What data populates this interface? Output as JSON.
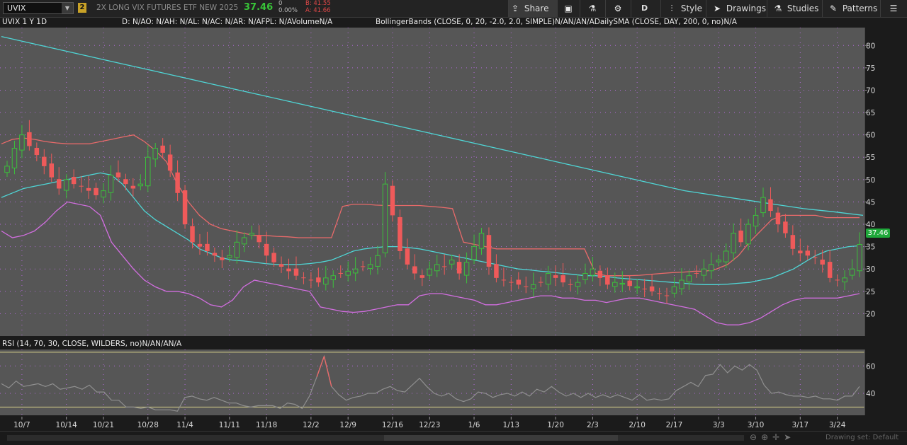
{
  "toolbar": {
    "symbol": "UVIX",
    "link_badge": "2",
    "description": "2X LONG VIX FUTURES ETF NEW 2025",
    "last": "37.46",
    "change": "0",
    "change_pct": "0.00%",
    "bid": "B: 41.55",
    "ask": "A: 41.66",
    "buttons": {
      "share": "Share",
      "period": "D",
      "style": "Style",
      "drawings": "Drawings",
      "studies": "Studies",
      "patterns": "Patterns"
    }
  },
  "header": {
    "chart_label": "UVIX 1 Y 1D",
    "ohlc": "D: N/AO: N/AH: N/AL: N/AC: N/AR: N/AFPL: N/AVolumeN/A",
    "studies": "BollingerBands (CLOSE, 0, 20, -2.0, 2.0, SIMPLE)N/AN/AN/ADailySMA (CLOSE, DAY, 200, 0, no)N/A"
  },
  "rsi_header": "RSI (14, 70, 30, CLOSE, WILDERS, no)N/AN/AN/A",
  "price_tag": "37.46",
  "footer": {
    "drawing_set": "Drawing set: Default"
  },
  "colors": {
    "up": "#3cbf3c",
    "down": "#ef5a5a",
    "upper_band": "#e86a6a",
    "middle_band": "#4fd6d6",
    "lower_band": "#d26ee0",
    "sma": "#4fd6d6",
    "rsi_line": "#8f8f8f",
    "rsi_over": "#e86a6a",
    "rsi_levels": "#d6d08a",
    "grid": "#b06ad6",
    "bg": "#565656",
    "last_tag": "#1fa83a"
  },
  "chart_data": [
    {
      "type": "candlestick",
      "y_axis_ticks": [
        20,
        25,
        30,
        35,
        40,
        45,
        50,
        55,
        60,
        65,
        70,
        75,
        80
      ],
      "ylim": [
        15,
        84
      ],
      "x_tick_labels": [
        "10/7",
        "10/14",
        "10/21",
        "10/28",
        "11/4",
        "11/11",
        "11/18",
        "12/2",
        "12/9",
        "12/16",
        "12/23",
        "1/6",
        "1/13",
        "1/20",
        "2/3",
        "2/10",
        "2/17",
        "3/3",
        "3/10",
        "3/17",
        "3/24"
      ],
      "grid": true,
      "closes": [
        53.0,
        57.0,
        60.0,
        57.5,
        55.5,
        53.0,
        50.5,
        48.0,
        50.0,
        49.0,
        48.5,
        47.5,
        46.5,
        47.5,
        51.0,
        50.5,
        49.0,
        48.0,
        49.0,
        55.0,
        57.0,
        56.0,
        52.0,
        47.0,
        40.0,
        36.0,
        35.0,
        34.0,
        33.0,
        32.0,
        33.0,
        36.0,
        37.0,
        38.0,
        36.0,
        33.0,
        31.5,
        30.5,
        29.5,
        28.5,
        28.0,
        27.5,
        27.0,
        28.0,
        28.5,
        29.0,
        29.5,
        30.0,
        30.5,
        31.0,
        33.0,
        49.0,
        42.0,
        34.0,
        31.0,
        29.0,
        28.0,
        30.0,
        31.0,
        30.5,
        32.0,
        29.0,
        31.5,
        35.0,
        38.0,
        30.5,
        28.0,
        27.5,
        27.0,
        26.5,
        26.0,
        26.5,
        27.0,
        29.0,
        28.0,
        27.0,
        26.5,
        27.0,
        29.0,
        30.0,
        28.0,
        26.5,
        27.0,
        26.8,
        26.2,
        26.0,
        25.5,
        25.0,
        24.5,
        24.0,
        26.0,
        27.5,
        28.5,
        29.0,
        30.0,
        31.0,
        32.0,
        34.0,
        38.0,
        36.0,
        40.0,
        42.0,
        46.0,
        43.0,
        40.0,
        38.0,
        34.5,
        33.5,
        33.0,
        32.5,
        31.0,
        28.0,
        27.5,
        28.0,
        30.0,
        35.5
      ],
      "series": [
        {
          "name": "BollingerBands upper",
          "values": [
            58.0,
            59.0,
            59.3,
            59.0,
            58.5,
            58.2,
            58.0,
            58.0,
            58.0,
            58.5,
            59.0,
            59.5,
            60.0,
            58.5,
            56.5,
            54.0,
            49.0,
            45.0,
            42.0,
            40.0,
            39.0,
            38.5,
            38.0,
            37.5,
            37.5,
            37.3,
            37.2,
            37.0,
            37.0,
            37.0,
            37.0,
            44.0,
            44.5,
            44.5,
            44.3,
            44.2,
            44.2,
            44.2,
            44.2,
            44.0,
            43.8,
            43.5,
            36.0,
            35.5,
            35.0,
            34.5,
            34.5,
            34.5,
            34.5,
            34.5,
            34.5,
            34.5,
            34.5,
            34.5,
            29.0,
            28.5,
            28.5,
            28.5,
            28.6,
            28.8,
            29.0,
            29.2,
            29.3,
            29.5,
            29.5,
            30.0,
            31.0,
            33.0,
            36.0,
            38.5,
            41.0,
            42.0,
            42.0,
            42.0,
            42.0,
            41.5,
            41.5,
            41.5,
            41.5
          ]
        },
        {
          "name": "BollingerBands middle",
          "values": [
            46.0,
            47.0,
            48.0,
            48.5,
            49.0,
            49.5,
            50.0,
            50.5,
            51.0,
            51.5,
            51.0,
            49.0,
            46.0,
            43.0,
            41.0,
            39.5,
            38.0,
            36.5,
            34.5,
            33.5,
            32.5,
            32.0,
            31.8,
            31.5,
            31.2,
            31.0,
            31.0,
            31.0,
            31.2,
            31.5,
            32.0,
            33.0,
            34.0,
            34.5,
            34.8,
            35.0,
            35.0,
            34.8,
            34.5,
            34.0,
            33.5,
            33.0,
            32.5,
            32.0,
            31.5,
            31.0,
            30.5,
            30.0,
            29.8,
            29.5,
            29.3,
            29.0,
            28.8,
            28.5,
            28.5,
            28.3,
            28.0,
            27.8,
            27.6,
            27.4,
            27.2,
            27.0,
            26.8,
            26.6,
            26.5,
            26.5,
            26.6,
            26.8,
            27.0,
            27.5,
            28.0,
            29.0,
            30.0,
            31.5,
            33.0,
            34.0,
            34.5,
            35.0,
            35.2
          ]
        },
        {
          "name": "BollingerBands lower",
          "values": [
            38.5,
            37.0,
            37.5,
            38.5,
            40.5,
            43.0,
            45.0,
            44.5,
            44.0,
            42.0,
            36.0,
            33.0,
            30.0,
            27.5,
            26.0,
            25.0,
            25.0,
            24.5,
            23.5,
            22.0,
            21.5,
            23.0,
            26.0,
            27.5,
            27.0,
            26.5,
            26.0,
            25.5,
            25.0,
            21.5,
            21.0,
            20.5,
            20.3,
            20.5,
            21.0,
            21.5,
            22.0,
            22.0,
            24.0,
            24.5,
            24.5,
            24.0,
            23.5,
            23.0,
            22.0,
            22.0,
            22.5,
            23.0,
            23.5,
            24.0,
            24.0,
            23.5,
            23.5,
            23.0,
            23.0,
            22.5,
            23.0,
            23.5,
            23.5,
            23.0,
            22.5,
            22.0,
            21.5,
            21.0,
            19.5,
            18.0,
            17.5,
            17.5,
            18.0,
            19.0,
            20.5,
            22.0,
            23.0,
            23.5,
            23.5,
            23.5,
            23.5,
            24.0,
            24.5
          ]
        },
        {
          "name": "DailySMA",
          "values": [
            82.0,
            80.5,
            79.0,
            77.5,
            76.0,
            74.5,
            73.0,
            71.5,
            70.0,
            68.5,
            67.0,
            65.5,
            64.0,
            62.5,
            61.0,
            59.5,
            58.0,
            56.5,
            55.0,
            53.5,
            52.0,
            50.5,
            49.0,
            47.5,
            46.5,
            45.5,
            44.5,
            43.5,
            42.8,
            42.0
          ]
        }
      ]
    },
    {
      "type": "line",
      "series": [
        {
          "name": "RSI",
          "values": [
            47,
            44,
            49,
            45,
            46,
            47,
            45,
            47,
            43,
            44,
            45,
            43,
            46,
            41,
            41,
            35,
            35,
            30,
            30,
            29,
            30,
            28,
            28,
            28,
            27,
            37,
            38,
            36,
            35,
            37,
            35,
            33,
            33,
            31,
            30,
            31,
            31,
            31,
            29,
            33,
            32,
            29,
            38,
            52,
            67,
            45,
            39,
            35,
            37,
            38,
            40,
            40,
            43,
            45,
            42,
            41,
            46,
            51,
            45,
            40,
            38,
            40,
            36,
            34,
            36,
            41,
            40,
            37,
            39,
            40,
            38,
            41,
            38,
            43,
            41,
            45,
            41,
            38,
            40,
            37,
            40,
            37,
            39,
            37,
            39,
            37,
            35,
            39,
            35,
            36,
            35,
            36,
            42,
            45,
            48,
            45,
            53,
            54,
            61,
            55,
            60,
            57,
            61,
            57,
            46,
            40,
            41,
            39,
            38,
            38,
            37,
            38,
            36,
            36,
            35,
            38,
            38,
            45
          ]
        }
      ],
      "y_axis_ticks": [
        40,
        60
      ],
      "levels": [
        70,
        30
      ],
      "ylim": [
        24,
        72
      ]
    }
  ]
}
